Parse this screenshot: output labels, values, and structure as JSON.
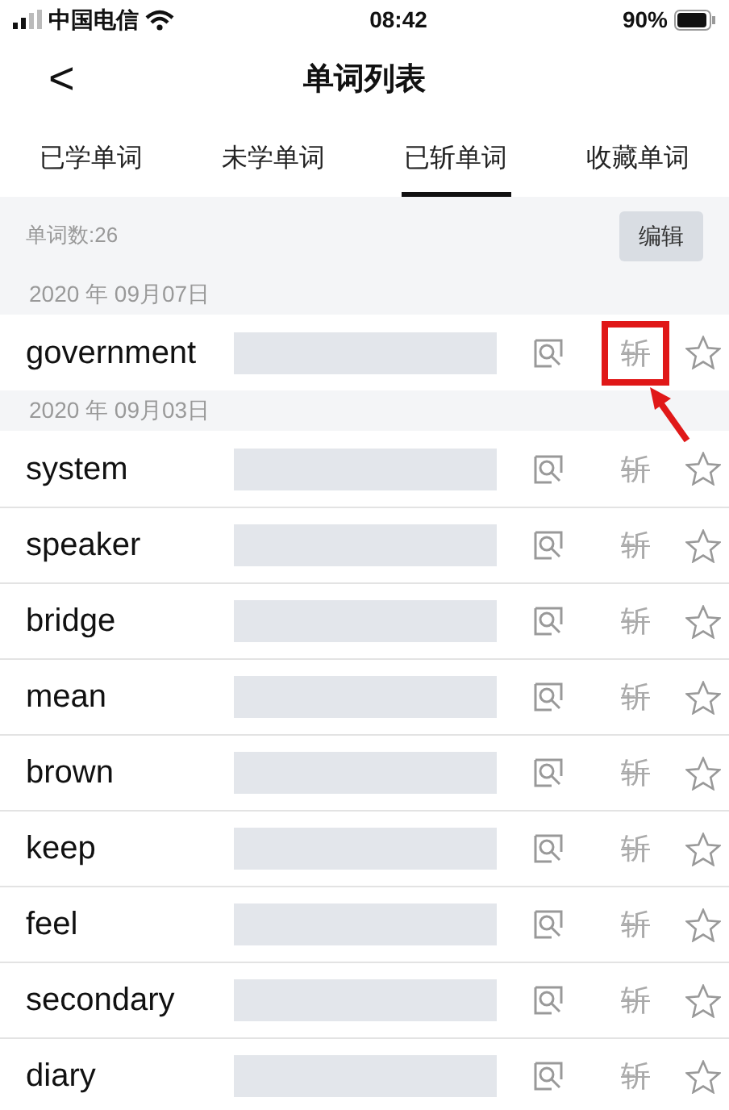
{
  "status_bar": {
    "carrier": "中国电信",
    "time": "08:42",
    "battery": "90%"
  },
  "header": {
    "back": "<",
    "title": "单词列表"
  },
  "tabs": [
    {
      "label": "已学单词",
      "selected": false
    },
    {
      "label": "未学单词",
      "selected": false
    },
    {
      "label": "已斩单词",
      "selected": true
    },
    {
      "label": "收藏单词",
      "selected": false
    }
  ],
  "summary": {
    "count": "单词数:26",
    "edit_button": "编辑"
  },
  "groups": [
    {
      "date": "2020 年 09月07日",
      "words": [
        {
          "word": "government",
          "chop": "斩",
          "highlighted": true
        }
      ]
    },
    {
      "date": "2020 年 09月03日",
      "words": [
        {
          "word": "system",
          "chop": "斩",
          "highlighted": false
        },
        {
          "word": "speaker",
          "chop": "斩",
          "highlighted": false
        },
        {
          "word": "bridge",
          "chop": "斩",
          "highlighted": false
        },
        {
          "word": "mean",
          "chop": "斩",
          "highlighted": false
        },
        {
          "word": "brown",
          "chop": "斩",
          "highlighted": false
        },
        {
          "word": "keep",
          "chop": "斩",
          "highlighted": false
        },
        {
          "word": "feel",
          "chop": "斩",
          "highlighted": false
        },
        {
          "word": "secondary",
          "chop": "斩",
          "highlighted": false
        },
        {
          "word": "diary",
          "chop": "斩",
          "highlighted": false
        }
      ]
    }
  ]
}
